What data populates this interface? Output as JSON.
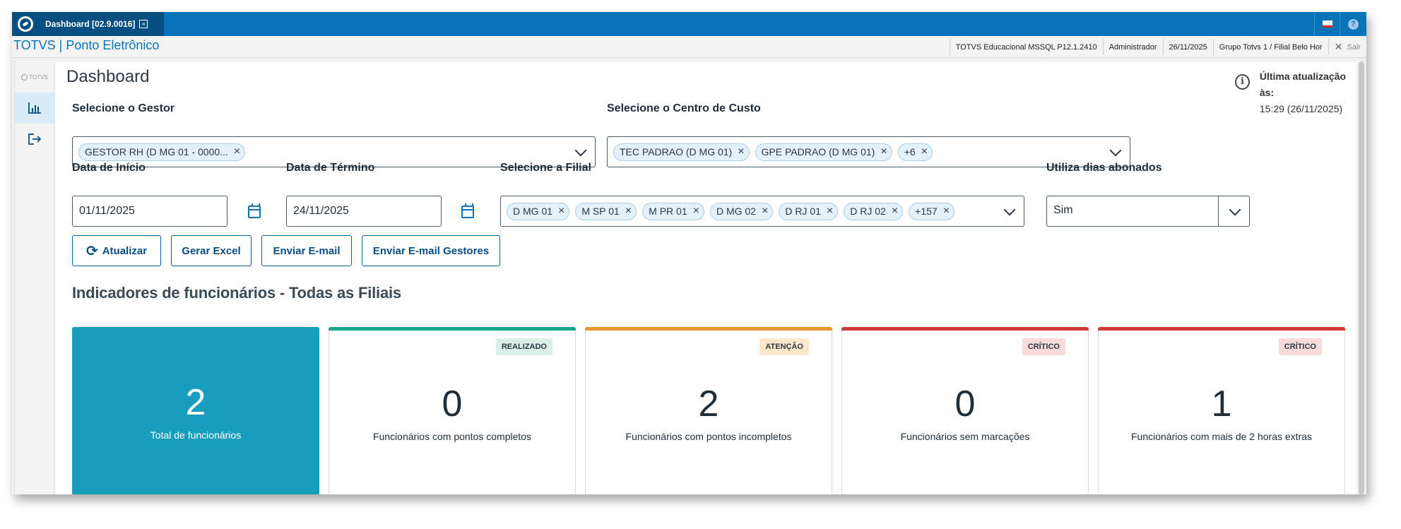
{
  "tabbar": {
    "tab_label": "Dashboard [02.9.0016]",
    "tab_close": "×"
  },
  "header": {
    "app_title": "TOTVS | Ponto Eletrônico",
    "environment": "TOTVS Educacional MSSQL P12.1.2410",
    "user": "Administrador",
    "date": "26/11/2025",
    "branch": "Grupo Totvs 1 / Filial Belo Hor",
    "logout_label": "Sair"
  },
  "sidebar": {
    "logo_text": "TOTVS",
    "items": [
      {
        "name": "dashboard",
        "icon": "bar-chart-icon"
      },
      {
        "name": "exit",
        "icon": "logout-icon"
      }
    ]
  },
  "main": {
    "title": "Dashboard",
    "update_label": "Última atualização às:",
    "update_value": "15:29 (26/11/2025)",
    "gestor": {
      "label": "Selecione o Gestor",
      "chips": [
        "GESTOR RH (D MG 01 - 0000..."
      ]
    },
    "centro_custo": {
      "label": "Selecione o Centro de Custo",
      "chips": [
        "TEC PADRAO (D MG 01)",
        "GPE PADRAO (D MG 01)",
        "+6"
      ]
    },
    "data_inicio": {
      "label": "Data de Início",
      "value": "01/11/2025"
    },
    "data_termino": {
      "label": "Data de Término",
      "value": "24/11/2025"
    },
    "filial": {
      "label": "Selecione a Filial",
      "chips": [
        "D MG 01",
        "M SP 01",
        "M PR 01",
        "D MG 02",
        "D RJ 01",
        "D RJ 02",
        "+157"
      ]
    },
    "dias_abonados": {
      "label": "Utiliza dias abonados",
      "value": "Sim"
    },
    "buttons": {
      "atualizar": "Atualizar",
      "gerar_excel": "Gerar Excel",
      "enviar_email": "Enviar E-mail",
      "enviar_email_gestores": "Enviar E-mail Gestores"
    },
    "section_title": "Indicadores de funcionários - Todas as Filiais",
    "cards": [
      {
        "value": "2",
        "label": "Total de funcionários",
        "badge": "",
        "color": "#179ebf"
      },
      {
        "value": "0",
        "label": "Funcionários com pontos completos",
        "badge": "REALIZADO",
        "color": "#1aa38a",
        "badge_bg": "#d9eee6"
      },
      {
        "value": "2",
        "label": "Funcionários com pontos incompletos",
        "badge": "ATENÇÃO",
        "color": "#e8953a",
        "badge_bg": "#fde6c9"
      },
      {
        "value": "0",
        "label": "Funcionários sem marcações",
        "badge": "CRÍTICO",
        "color": "#cf3a3a",
        "badge_bg": "#f8dada"
      },
      {
        "value": "1",
        "label": "Funcionários com mais de 2 horas extras",
        "badge": "CRÍTICO",
        "color": "#cf3a3a",
        "badge_bg": "#f8dada"
      }
    ]
  },
  "colors": {
    "brand_blue": "#0a74b8",
    "dark_blue": "#064f80",
    "total_card": "#179ebf"
  }
}
